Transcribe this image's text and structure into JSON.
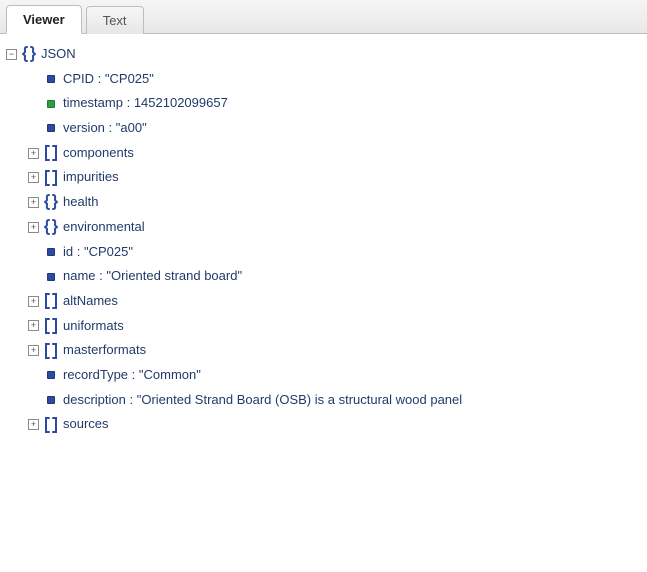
{
  "tabs": {
    "viewer": "Viewer",
    "text": "Text"
  },
  "root": {
    "label": "JSON"
  },
  "rows": [
    {
      "key": "CPID",
      "value": "\"CP025\"",
      "bullet": "blue"
    },
    {
      "key": "timestamp",
      "value": "1452102099657",
      "bullet": "green"
    },
    {
      "key": "version",
      "value": "\"a00\"",
      "bullet": "blue"
    },
    {
      "key": "components",
      "kind": "array"
    },
    {
      "key": "impurities",
      "kind": "array"
    },
    {
      "key": "health",
      "kind": "object"
    },
    {
      "key": "environmental",
      "kind": "object"
    },
    {
      "key": "id",
      "value": "\"CP025\"",
      "bullet": "blue"
    },
    {
      "key": "name",
      "value": "\"Oriented strand board\"",
      "bullet": "blue"
    },
    {
      "key": "altNames",
      "kind": "array"
    },
    {
      "key": "uniformats",
      "kind": "array"
    },
    {
      "key": "masterformats",
      "kind": "array"
    },
    {
      "key": "recordType",
      "value": "\"Common\"",
      "bullet": "blue"
    },
    {
      "key": "description",
      "value": "\"Oriented Strand Board (OSB) is a structural wood panel",
      "bullet": "blue"
    },
    {
      "key": "sources",
      "kind": "array"
    }
  ]
}
